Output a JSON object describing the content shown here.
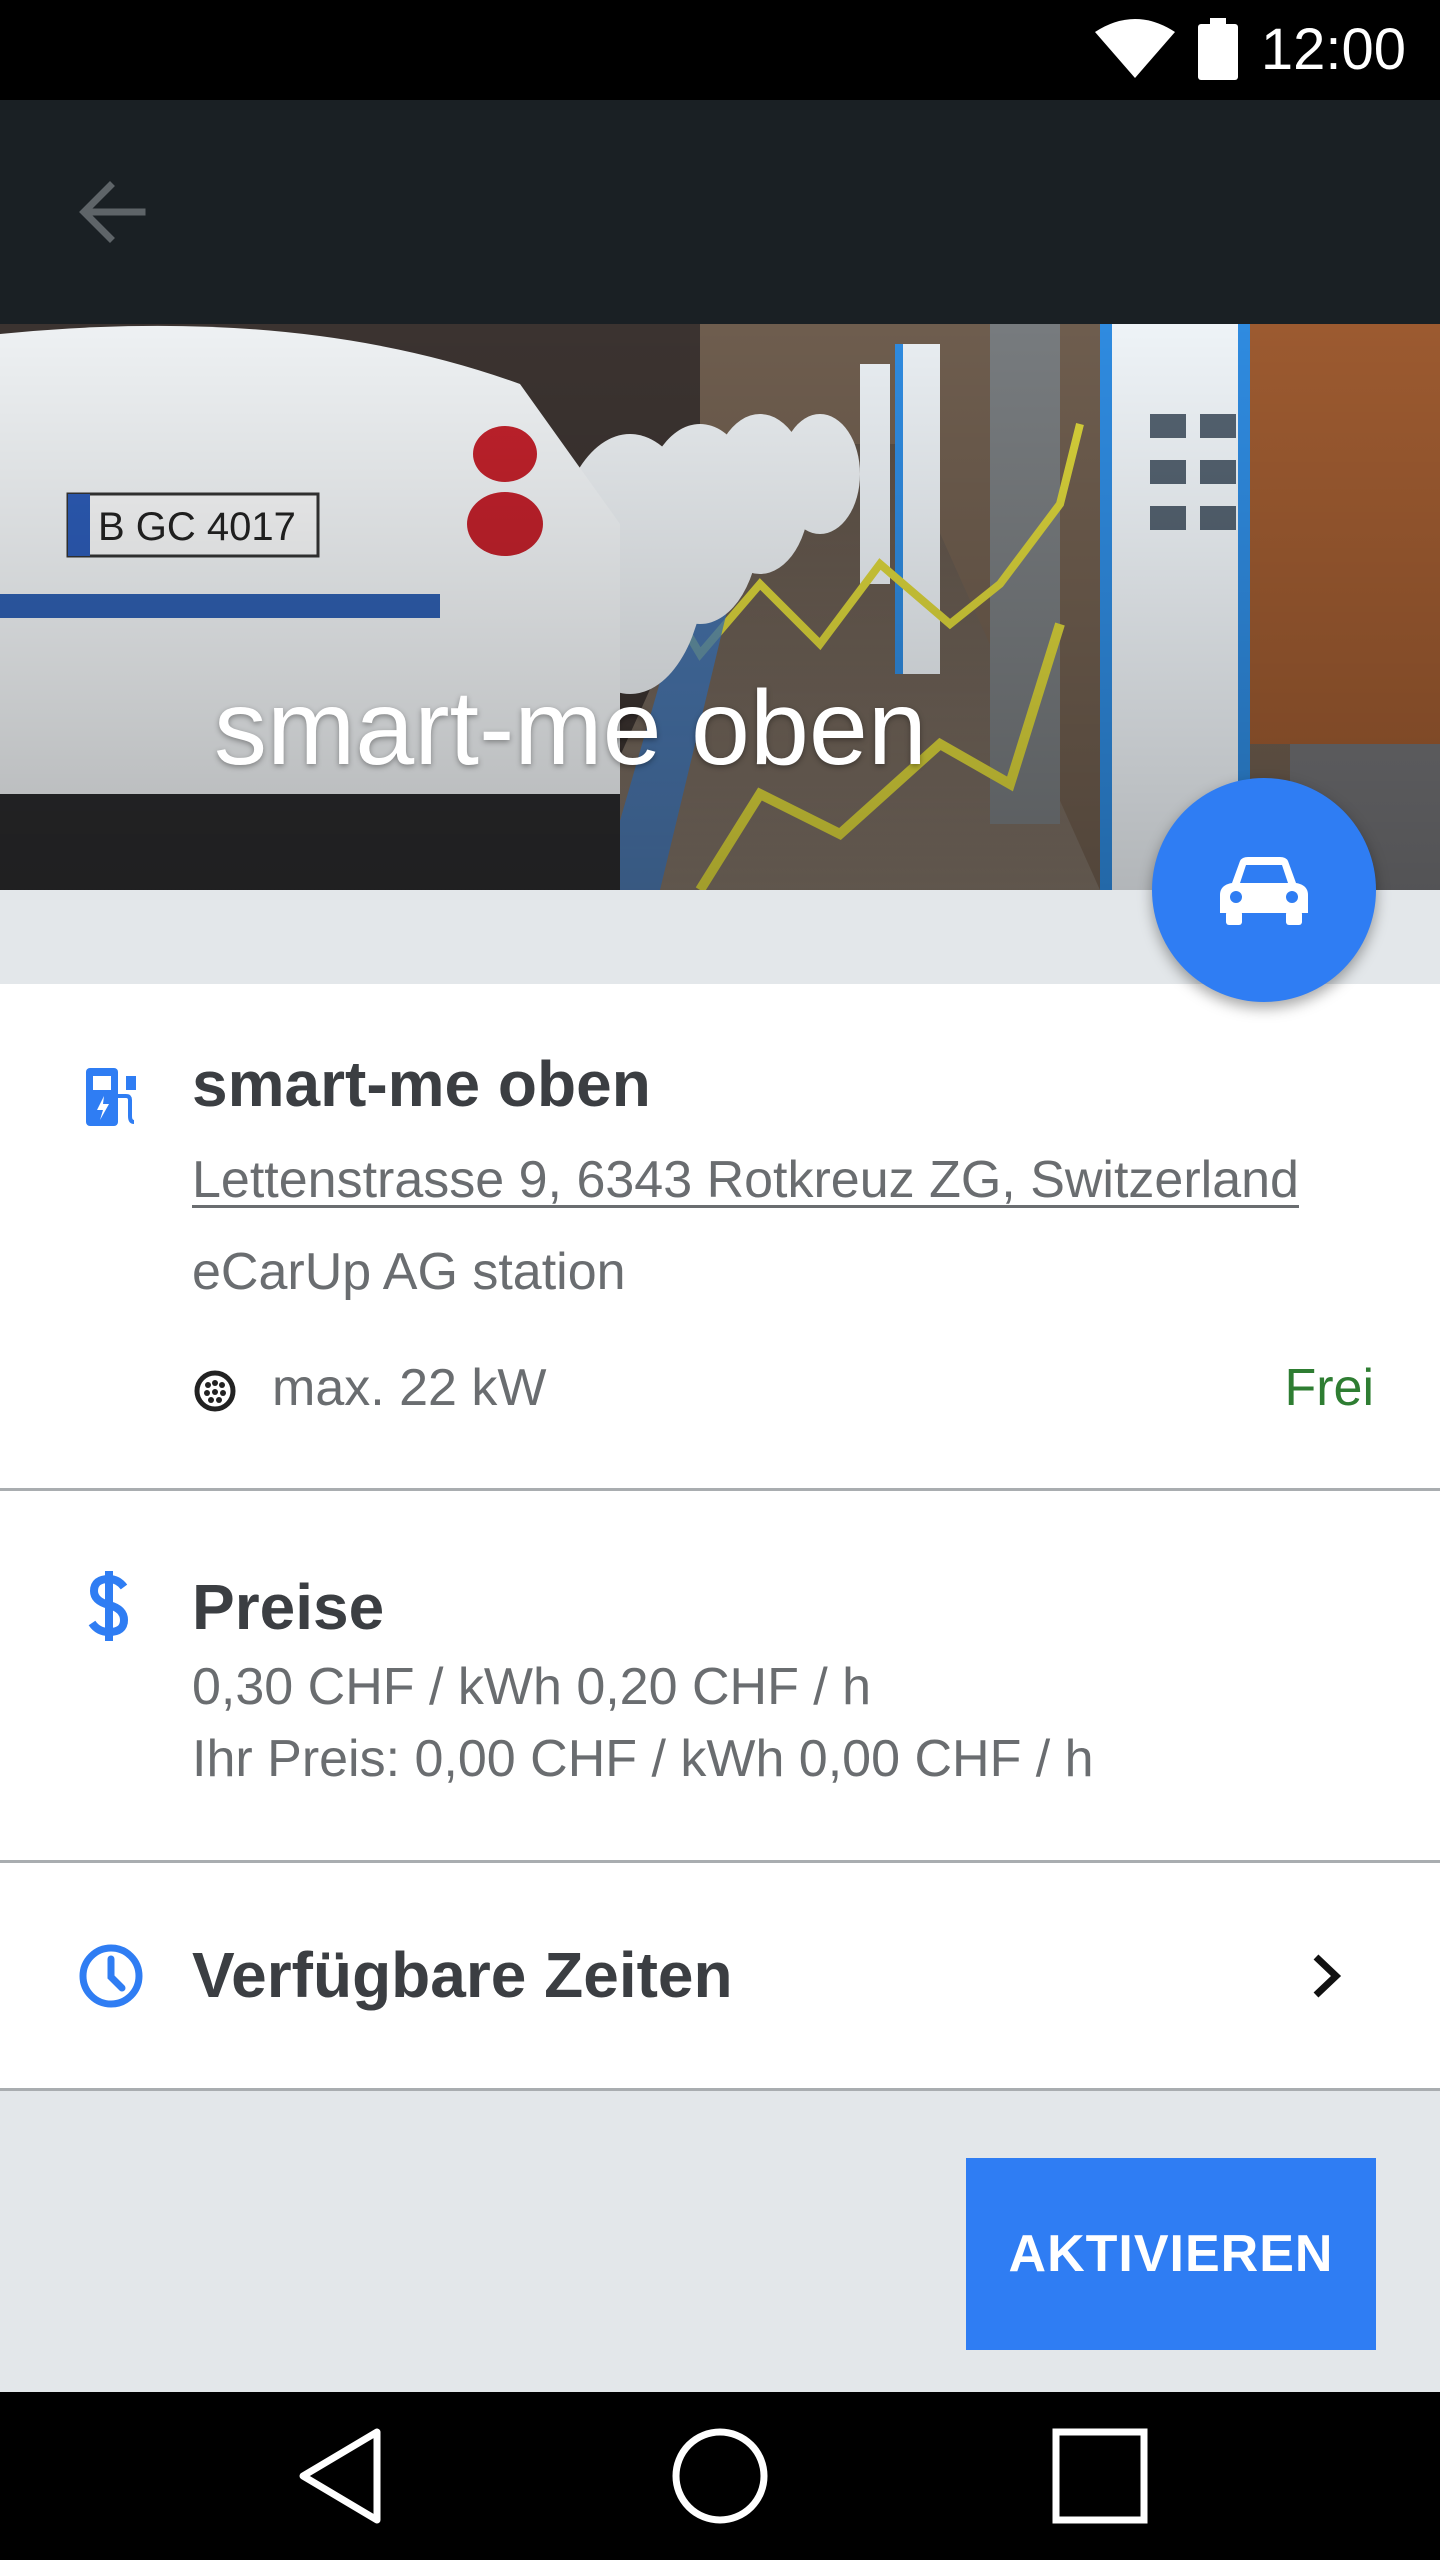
{
  "status_bar": {
    "time": "12:00"
  },
  "toolbar": {
    "back_icon": "arrow-back-icon"
  },
  "hero": {
    "title": "smart-me oben"
  },
  "fab": {
    "icon": "car-icon",
    "color": "#2f7df3"
  },
  "station": {
    "name": "smart-me oben",
    "address": "Lettenstrasse 9, 6343 Rotkreuz ZG, Switzerland",
    "operator": "eCarUp AG station",
    "max_power": "max. 22 kW",
    "status": "Frei",
    "status_color": "#2e7d32",
    "icon": "charging-station-icon",
    "connector_icon": "connector-icon"
  },
  "prices": {
    "title": "Preise",
    "standard": "0,30 CHF / kWh  0,20 CHF / h",
    "yours": "Ihr Preis: 0,00 CHF  / kWh  0,00 CHF / h",
    "icon": "dollar-icon"
  },
  "times": {
    "title": "Verfügbare Zeiten",
    "icon": "clock-icon",
    "chevron": "chevron-right-icon"
  },
  "actions": {
    "activate_label": "AKTIVIEREN"
  },
  "nav": {
    "back": "nav-back-icon",
    "home": "nav-home-icon",
    "recents": "nav-recents-icon"
  }
}
